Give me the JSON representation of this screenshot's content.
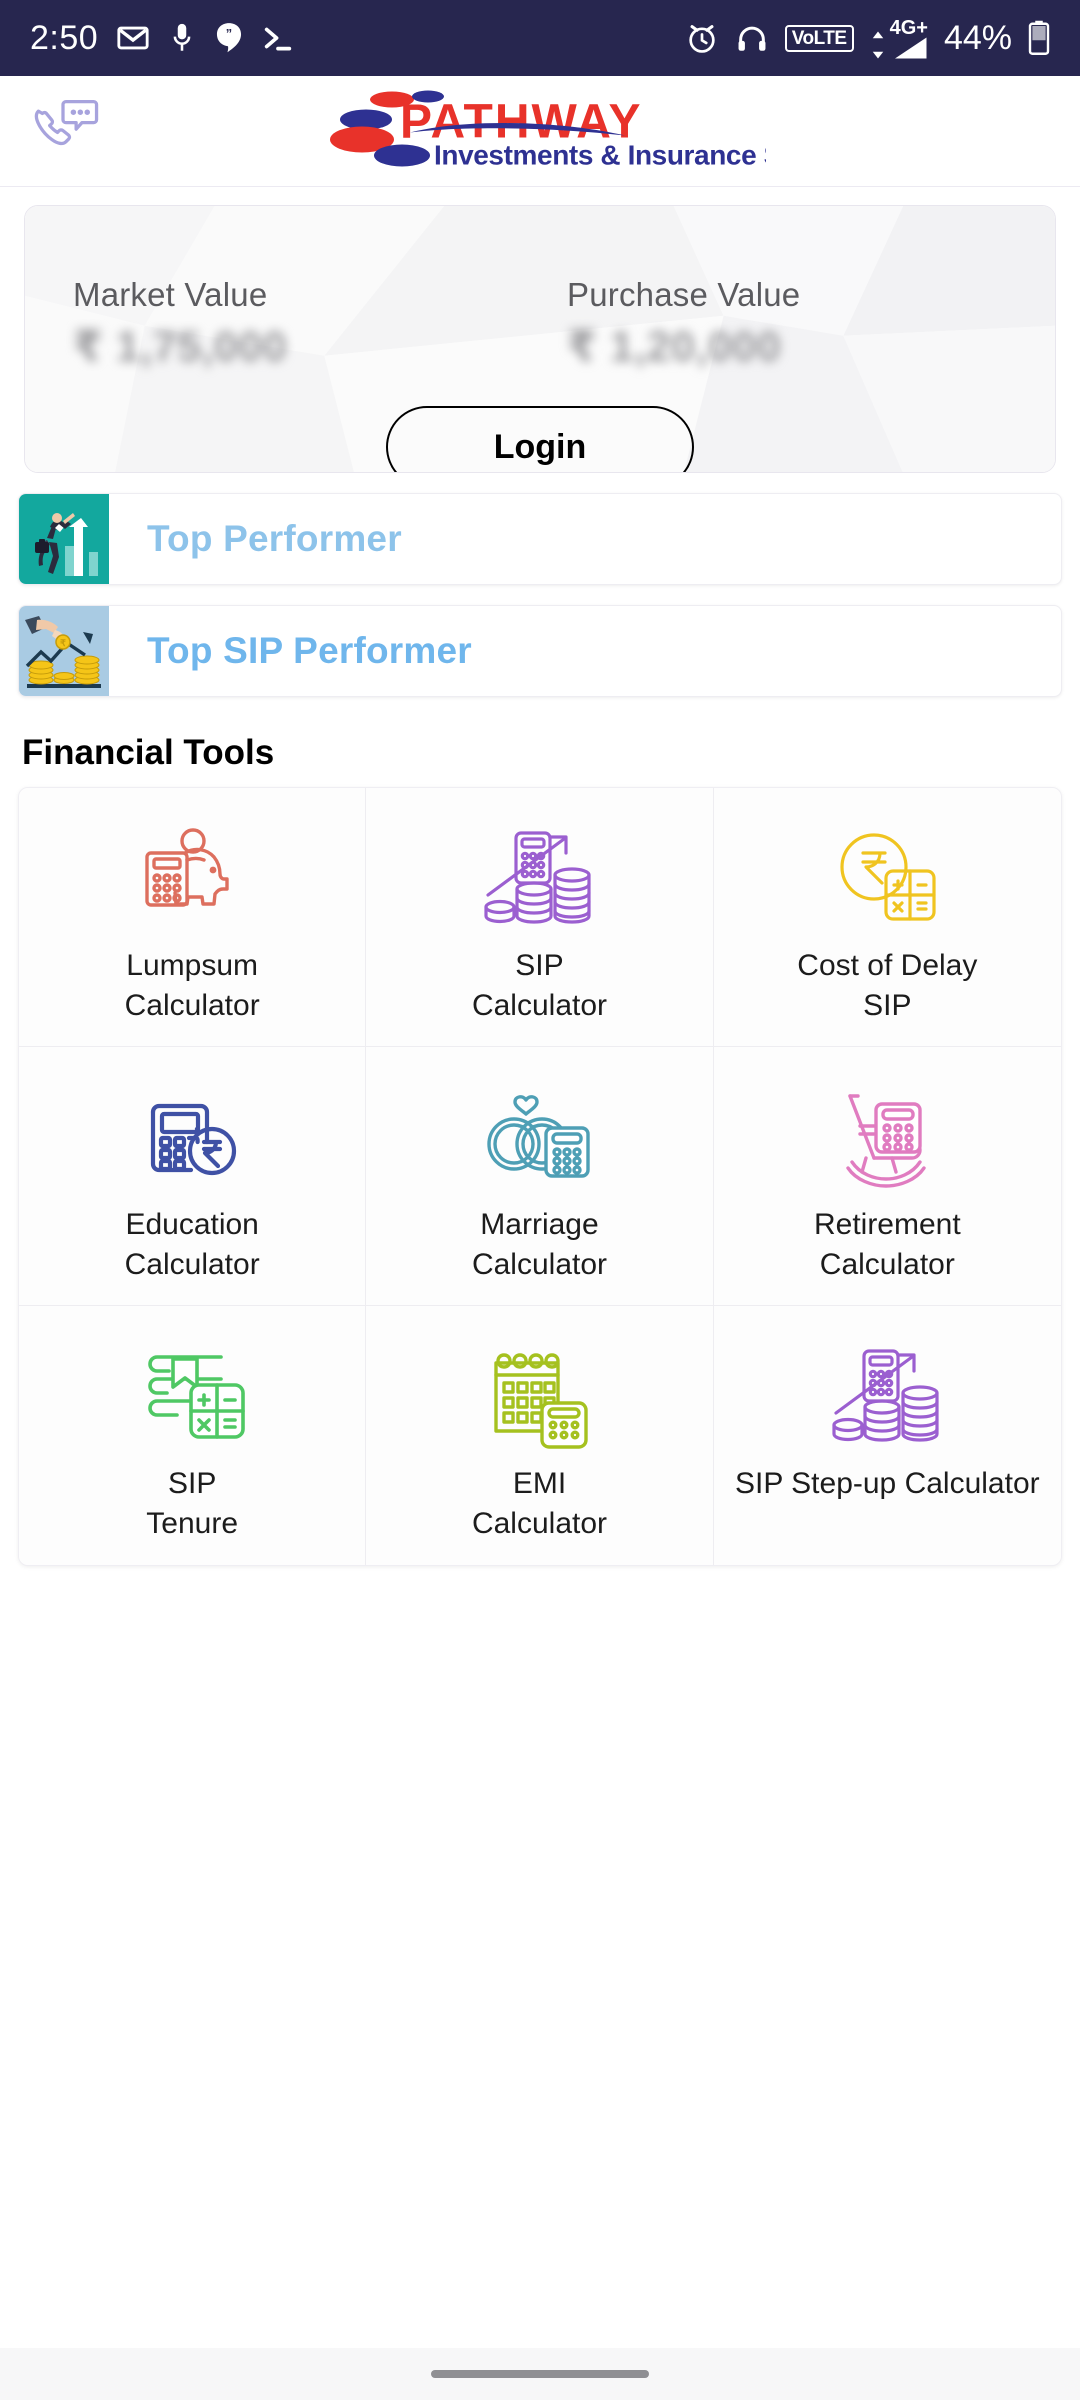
{
  "status_bar": {
    "clock": "2:50",
    "battery_percent": "44%",
    "network_type": "4G+",
    "volte_label": "VoLTE",
    "background_color": "#27264f",
    "left_icons": [
      "gmail-icon",
      "microphone-icon",
      "hangouts-icon",
      "terminal-icon"
    ],
    "right_icons": [
      "alarm-icon",
      "headphones-icon",
      "volte-badge",
      "signal-icon",
      "battery-icon"
    ]
  },
  "header": {
    "call_icon_name": "phone-chat-icon",
    "logo": {
      "brand": "PATHWAY",
      "tagline": "Investments & Insurance Services",
      "brand_color": "#e8322a",
      "tagline_color": "#2e3192"
    }
  },
  "portfolio": {
    "market_value_label": "Market Value",
    "market_value_amount": "₹ 1,75,000",
    "purchase_value_label": "Purchase Value",
    "purchase_value_amount": "₹ 1,20,000",
    "values_blurred": true,
    "login_label": "Login"
  },
  "performers": [
    {
      "label": "Top Performer",
      "icon": "businessman-growth-chart-icon",
      "icon_bg": "#13a89e",
      "text_color": "#8dc3ea"
    },
    {
      "label": "Top SIP Performer",
      "icon": "hand-coins-growth-icon",
      "icon_bg": "#a9cbe3",
      "text_color": "#6fb6ec"
    }
  ],
  "financial_tools": {
    "heading": "Financial Tools",
    "items": [
      {
        "label": "Lumpsum\nCalculator",
        "icon": "piggy-bank-calculator-icon",
        "color": "#dd6f5e"
      },
      {
        "label": "SIP\nCalculator",
        "icon": "calculator-coins-arrow-icon",
        "color": "#9b5fd0"
      },
      {
        "label": "Cost of Delay\nSIP",
        "icon": "rupee-coin-keypad-icon",
        "color": "#f0c420"
      },
      {
        "label": "Education\nCalculator",
        "icon": "calculator-rupee-coin-icon",
        "color": "#3f51a5"
      },
      {
        "label": "Marriage\nCalculator",
        "icon": "wedding-rings-calculator-icon",
        "color": "#4e9fb5"
      },
      {
        "label": "Retirement\nCalculator",
        "icon": "rocking-chair-calculator-icon",
        "color": "#e07cc0"
      },
      {
        "label": "SIP\nTenure",
        "icon": "notebook-keypad-icon",
        "color": "#4fc864"
      },
      {
        "label": "EMI\nCalculator",
        "icon": "calendar-calculator-icon",
        "color": "#a5c11f"
      },
      {
        "label": "SIP Step-up Calculator",
        "icon": "calculator-coins-arrow-icon",
        "color": "#9b5fd0"
      }
    ]
  },
  "nav_bar": {
    "handle_name": "home-gesture-pill"
  }
}
